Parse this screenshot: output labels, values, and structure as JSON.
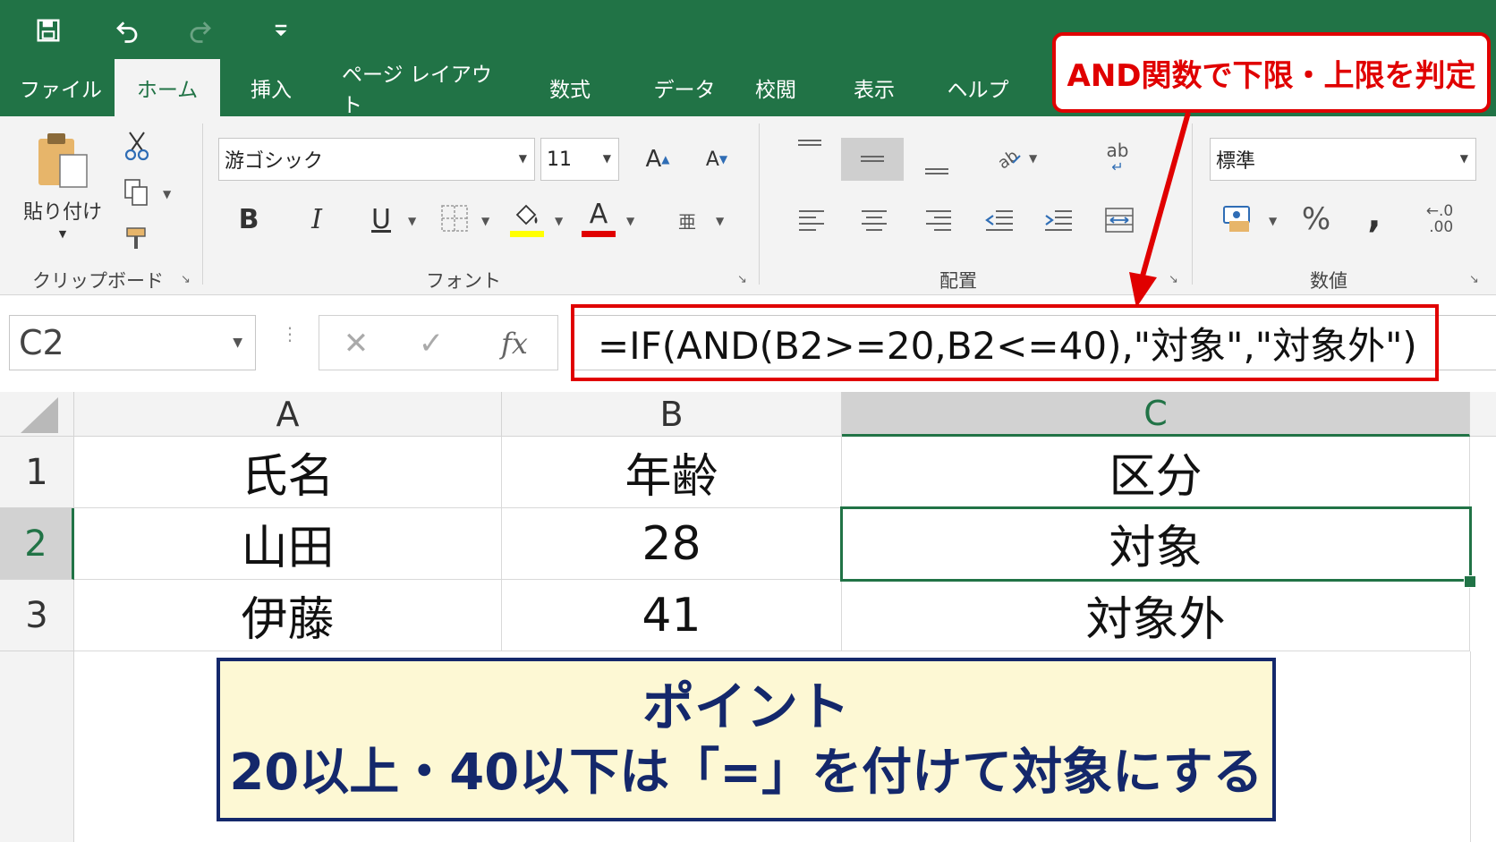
{
  "quick_access": {
    "icons": [
      "save-icon",
      "undo-icon",
      "redo-icon",
      "customize-dropdown-icon"
    ]
  },
  "tabs": [
    {
      "label": "ファイル"
    },
    {
      "label": "ホーム",
      "active": true
    },
    {
      "label": "挿入"
    },
    {
      "label": "ページ レイアウト"
    },
    {
      "label": "数式"
    },
    {
      "label": "データ"
    },
    {
      "label": "校閲"
    },
    {
      "label": "表示"
    },
    {
      "label": "ヘルプ"
    }
  ],
  "ribbon": {
    "clipboard": {
      "paste_label": "貼り付け",
      "group_label": "クリップボード",
      "icons": [
        "paste-icon",
        "cut-icon",
        "copy-icon",
        "format-painter-icon"
      ]
    },
    "font": {
      "font_name": "游ゴシック",
      "font_size": "11",
      "bold": "B",
      "italic": "I",
      "underline": "U",
      "font_color_glyph": "A",
      "grow_glyph": "A",
      "shrink_glyph": "A",
      "phonetic_glyph": "亜",
      "group_label": "フォント",
      "fill_color": "#ffff00",
      "font_color": "#e00000"
    },
    "alignment": {
      "group_label": "配置",
      "wrap_glyph": "ab"
    },
    "number": {
      "format": "標準",
      "percent": "%",
      "comma": ",",
      "decimal_glyph": "←.0\n.00",
      "group_label": "数値"
    }
  },
  "formula_bar": {
    "name_box": "C2",
    "fx_label": "fx",
    "formula": "=IF(AND(B2>=20,B2<=40),\"対象\",\"対象外\")"
  },
  "sheet": {
    "columns": [
      "A",
      "B",
      "C"
    ],
    "selected_column": "C",
    "rows": [
      {
        "num": "1",
        "cells": [
          "氏名",
          "年齢",
          "区分"
        ]
      },
      {
        "num": "2",
        "cells": [
          "山田",
          "28",
          "対象"
        ],
        "selected": true
      },
      {
        "num": "3",
        "cells": [
          "伊藤",
          "41",
          "対象外"
        ]
      }
    ],
    "active_cell": "C2"
  },
  "annotations": {
    "top_callout": "AND関数で下限・上限を判定",
    "point_title": "ポイント",
    "point_body": "20以上・40以下は「=」を付けて対象にする",
    "accent_red": "#e00000",
    "accent_navy": "#14286b",
    "excel_green": "#217346"
  }
}
